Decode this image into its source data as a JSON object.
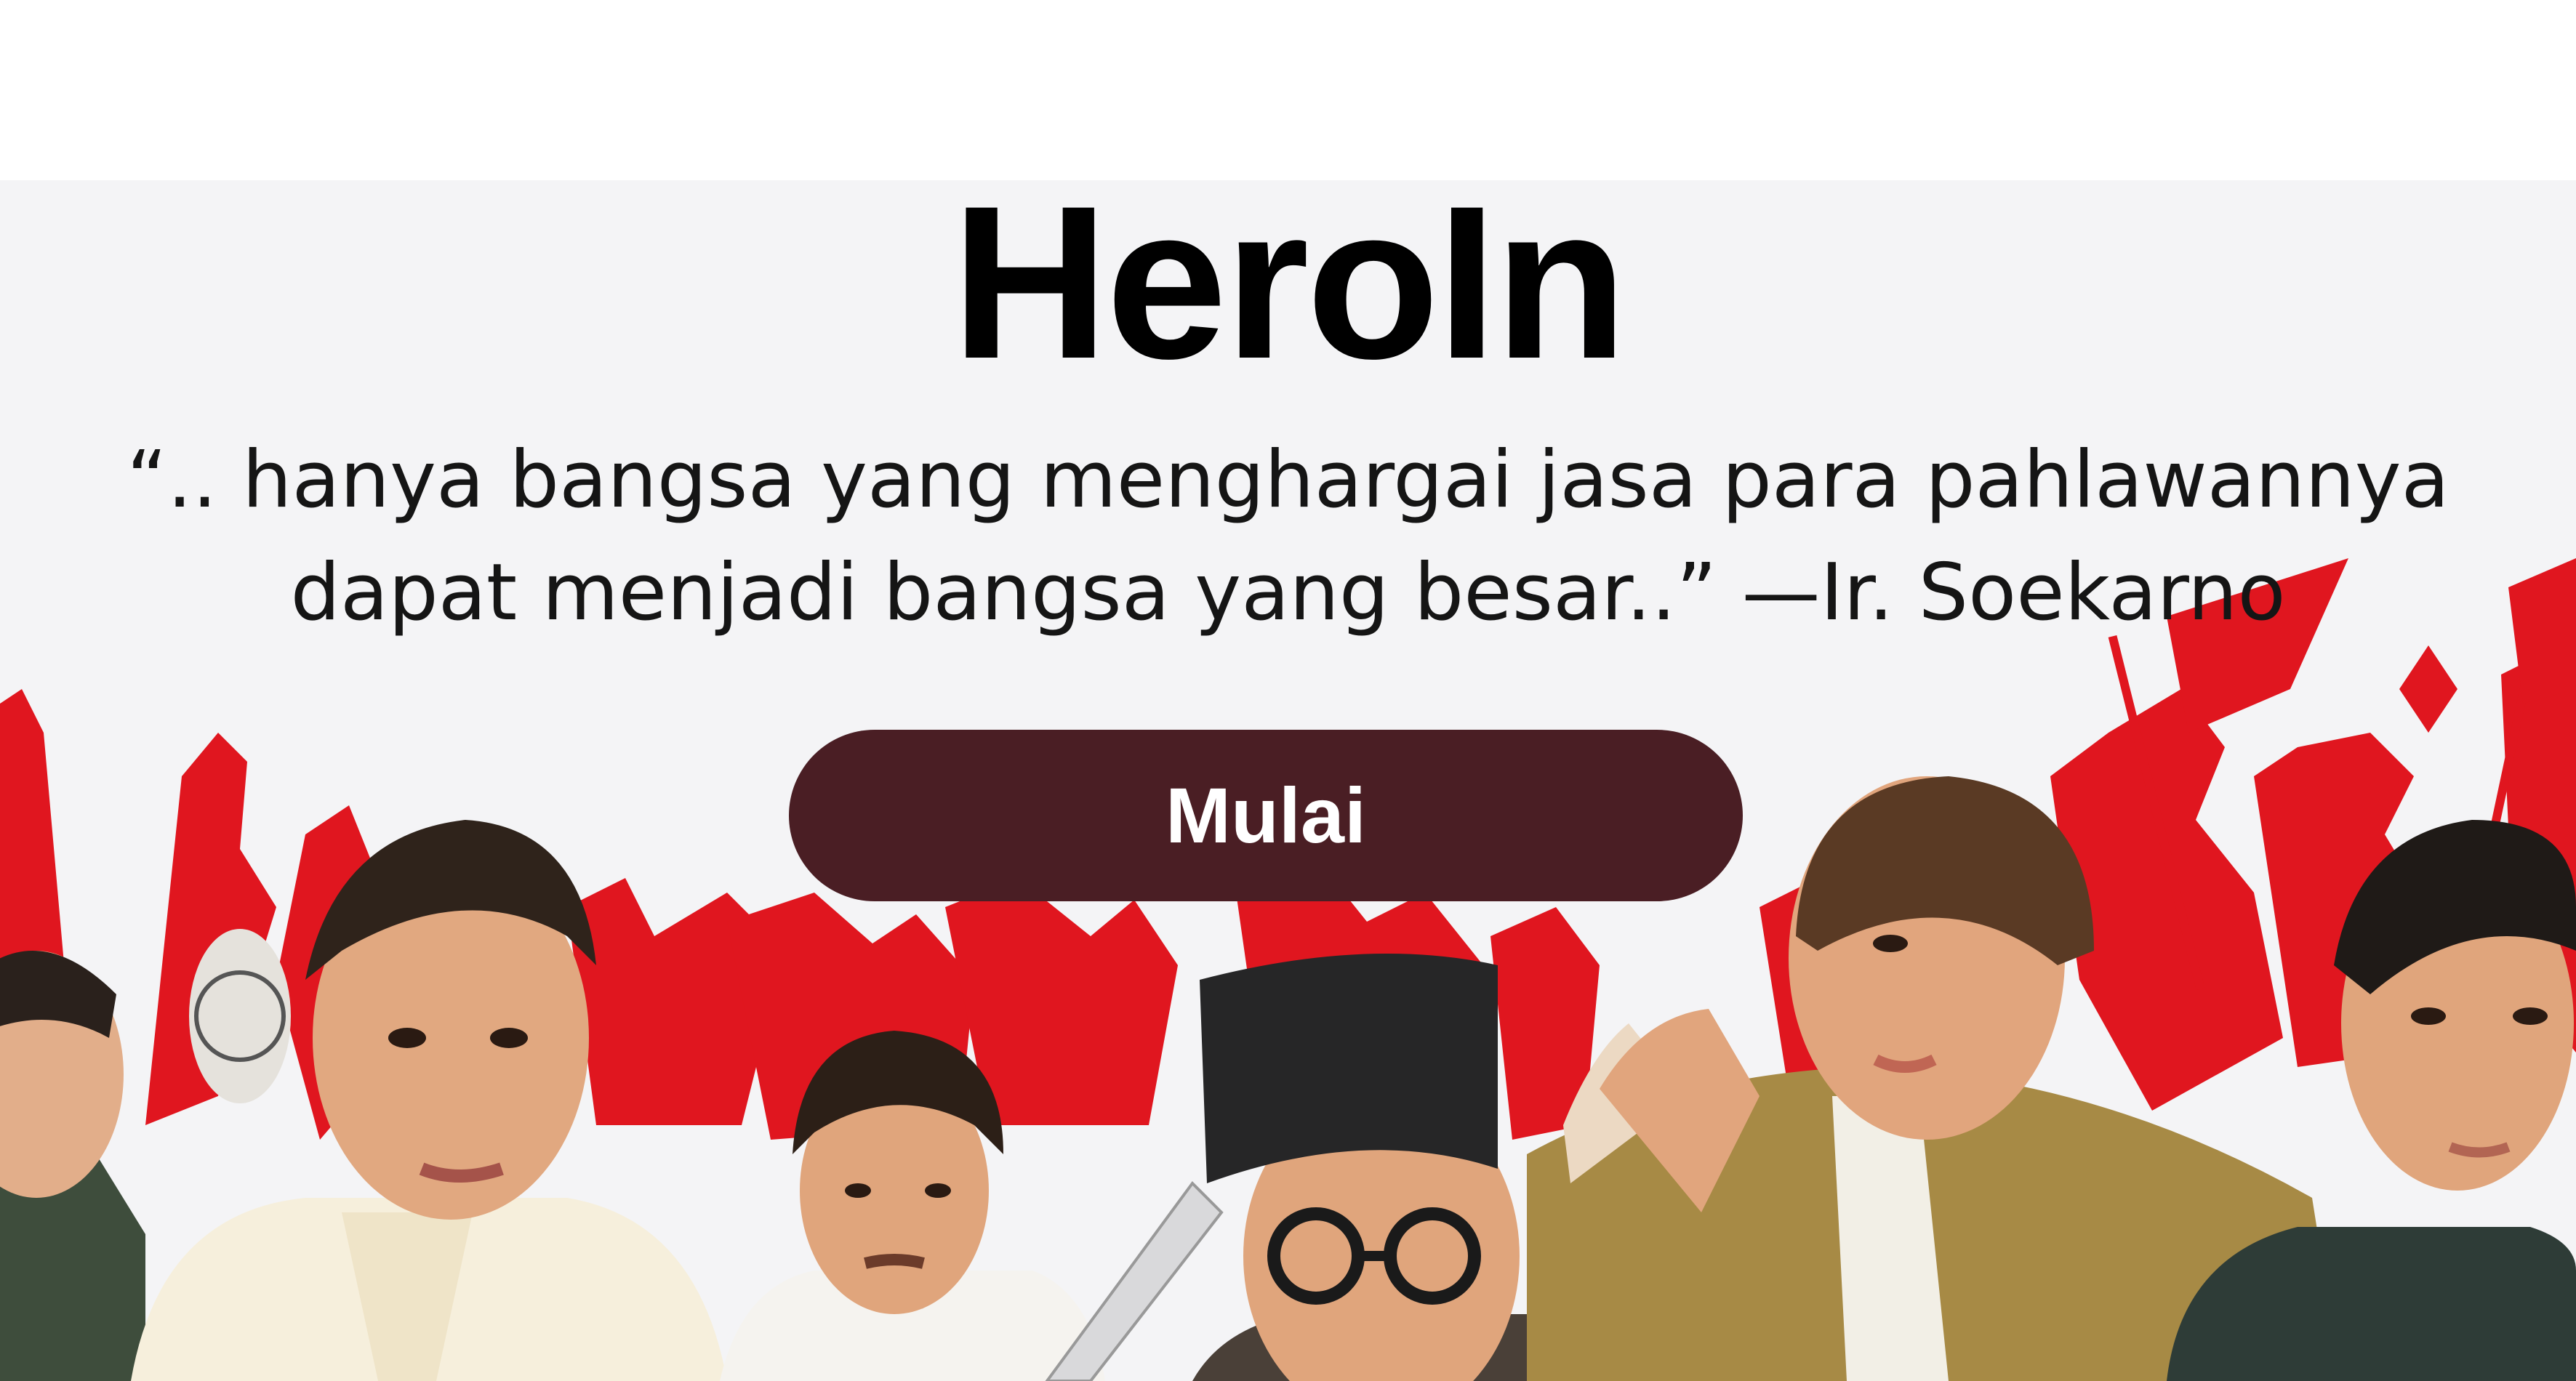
{
  "header": {
    "title": "HeroIn"
  },
  "hero": {
    "quote": "“.. hanya bangsa yang menghargai jasa para pahlawannya dapat menjadi bangsa yang besar..” —Ir. Soekarno",
    "start_label": "Mulai",
    "illustration": "indonesian-heroes-illustration"
  },
  "colors": {
    "button_bg": "#4a1e24",
    "accent_red": "#e0161f",
    "page_bg": "#f4f4f6"
  }
}
